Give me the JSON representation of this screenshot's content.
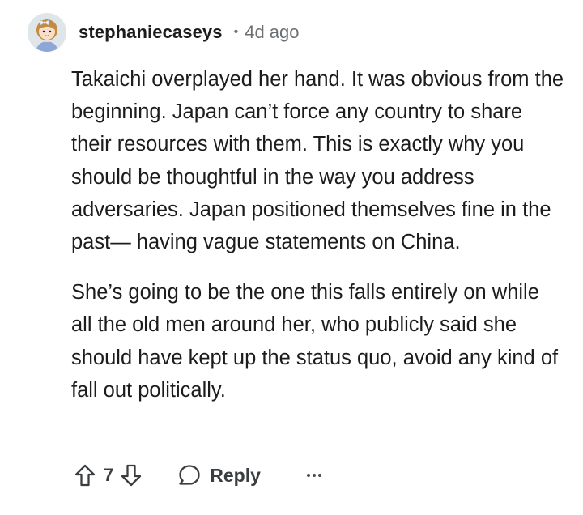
{
  "comment": {
    "username": "stephaniecaseys",
    "separator": "•",
    "timestamp": "4d ago",
    "paragraphs": [
      "Takaichi overplayed her hand. It was obvious from the beginning. Japan can’t force any country to share their resources with them. This is exactly why you should be thoughtful in the way you address adversaries. Japan positioned themselves fine in the past— having vague statements on China.",
      "She’s going to be the one this falls entirely on while all the old men around her, who publicly said she should have kept up the status quo, avoid any kind of fall out politically."
    ],
    "votes": "7",
    "reply_label": "Reply"
  },
  "icons": {
    "avatar": "avatar-illustration",
    "upvote": "arrow-up-icon",
    "downvote": "arrow-down-icon",
    "reply": "speech-bubble-icon",
    "more": "more-options-icon"
  },
  "colors": {
    "text": "#1c1c1c",
    "meta": "#6b6f73",
    "action": "#3b3e41"
  }
}
